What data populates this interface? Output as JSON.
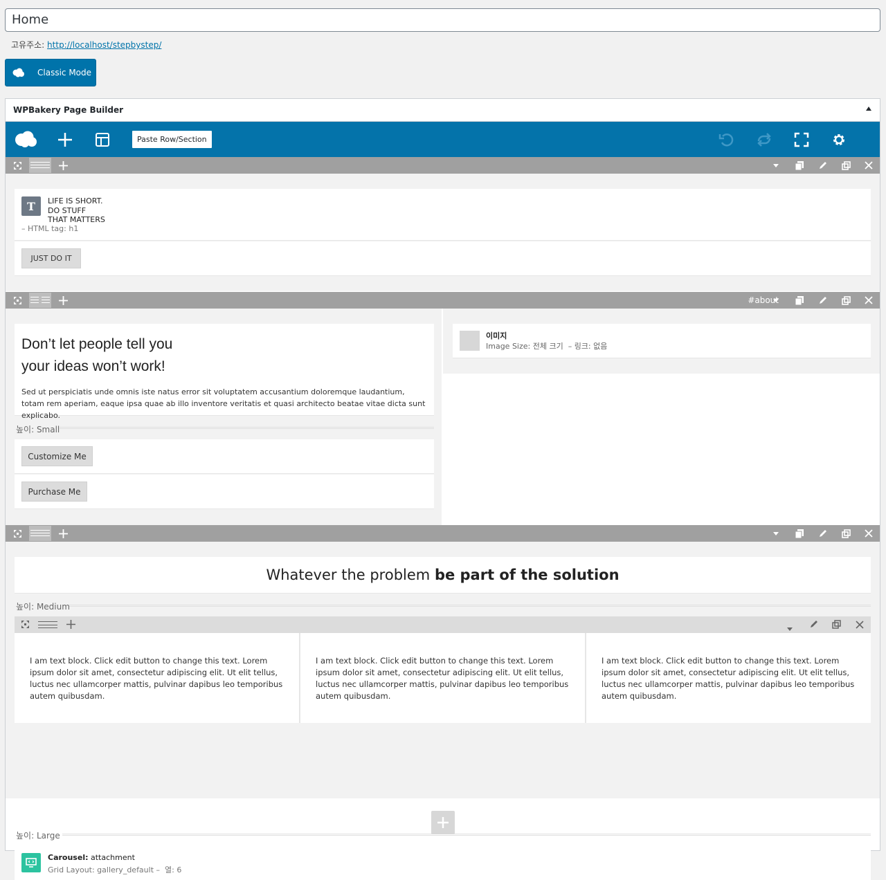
{
  "page_title": "Home",
  "permalink": {
    "label": "고유주소:",
    "url": "http://localhost/stepbystep/"
  },
  "classic_mode_label": "Classic Mode",
  "panel": {
    "title": "WPBakery Page Builder",
    "toolbar": {
      "paste_label": "Paste Row/Section"
    }
  },
  "rows": {
    "row1": {
      "heading": {
        "line1": "LIFE IS SHORT.",
        "line2": "DO STUFF",
        "line3": "THAT MATTERS",
        "meta": "– HTML tag: h1"
      },
      "button_label": "JUST DO IT"
    },
    "row2": {
      "tag": "#about",
      "headline1": "Don’t let people tell you",
      "headline2": "your ideas won’t work!",
      "body": "Sed ut perspiciatis unde omnis iste natus error sit voluptatem accusantium doloremque laudantium, totam rem aperiam, eaque ipsa quae ab illo inventore veritatis et quasi architecto beatae vitae dicta sunt explicabo.",
      "separator": "높이: Small",
      "button1": "Customize Me",
      "button2": "Purchase Me",
      "image": {
        "title": "이미지",
        "meta": "Image Size: 전체 크기  – 링크: 없음"
      }
    },
    "row3": {
      "heading_light": "Whatever the problem",
      "heading_bold": "be part of the solution",
      "separator_medium": "높이: Medium",
      "text_block": "I am text block. Click edit button to change this text. Lorem ipsum dolor sit amet, consectetur adipiscing elit. Ut elit tellus, luctus nec ullamcorper mattis, pulvinar dapibus leo temporibus autem quibusdam.",
      "separator_large": "높이: Large",
      "carousel": {
        "label": "Carousel:",
        "value": "attachment",
        "meta": "Grid Layout: gallery_default –  열: 6"
      }
    }
  },
  "colors": {
    "accent": "#0473aa",
    "row_bar": "#a0a0a0",
    "carousel_icon": "#2cc3a0"
  }
}
